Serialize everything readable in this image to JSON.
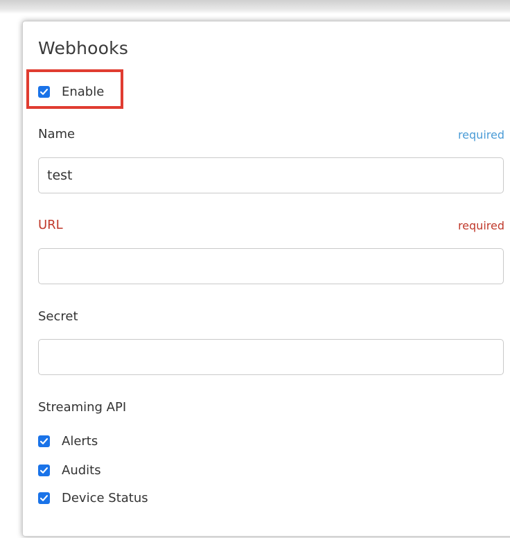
{
  "webhooks": {
    "title": "Webhooks",
    "enable": {
      "label": "Enable",
      "checked": true
    },
    "fields": {
      "name": {
        "label": "Name",
        "required_text": "required",
        "value": "test"
      },
      "url": {
        "label": "URL",
        "required_text": "required",
        "value": ""
      },
      "secret": {
        "label": "Secret",
        "value": ""
      }
    },
    "streaming_api": {
      "label": "Streaming API",
      "items": [
        {
          "label": "Alerts",
          "checked": true
        },
        {
          "label": "Audits",
          "checked": true
        },
        {
          "label": "Device Status",
          "checked": true
        }
      ]
    }
  },
  "colors": {
    "checkbox": "#1a73e8",
    "required_info": "#4a9bd6",
    "error": "#c0392b",
    "highlight": "#e03c31"
  }
}
